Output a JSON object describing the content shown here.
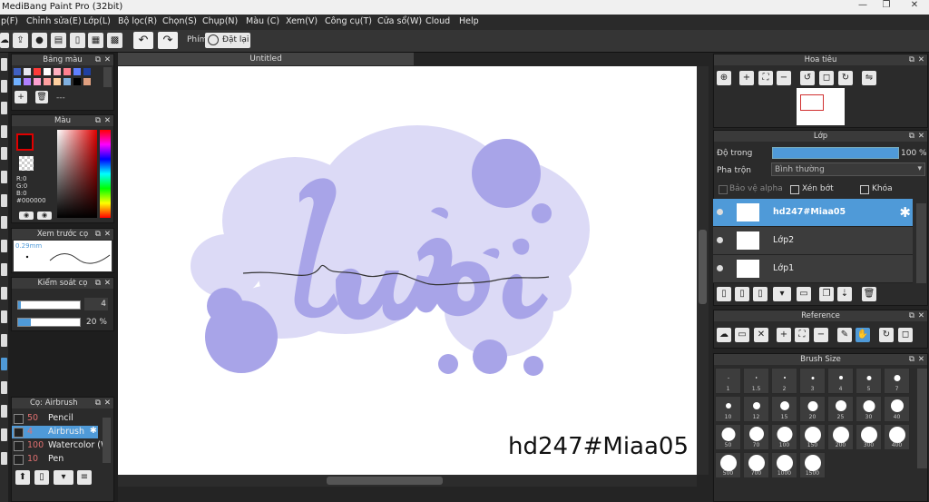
{
  "window": {
    "title": "MediBang Paint Pro (32bit)",
    "minimize": "—",
    "restore": "❐",
    "close": "✕"
  },
  "menu": [
    "p(F)",
    "Chỉnh sửa(E)",
    "Lớp(L)",
    "Bộ lọc(R)",
    "Chọn(S)",
    "Chụp(N)",
    "Màu (C)",
    "Xem(V)",
    "Công cụ(T)",
    "Cửa sổ(W)",
    "Cloud",
    "Help"
  ],
  "toolbar": {
    "shortcut_label": "Phím",
    "reset_label": "Đặt lại"
  },
  "canvas": {
    "tab_title": "Untitled",
    "artwork_text": "lười",
    "watermark": "hd247#Miaa05"
  },
  "palette": {
    "title": "Bảng màu",
    "field_value": "---",
    "colors": [
      "#4060c0",
      "#e8e8f0",
      "#ff3a3a",
      "#ffffff",
      "#ffb0c0",
      "#ff8090",
      "#6080ff",
      "#2040a0",
      "#70b0ff",
      "#b080ff",
      "#ffa0d0",
      "#ffa0a0",
      "#ffd0a0",
      "#80b0e0",
      "#000000",
      "#e0a080"
    ]
  },
  "color_panel": {
    "title": "Màu",
    "r": "R:0",
    "g": "G:0",
    "b": "B:0",
    "hex": "#000000",
    "primary": "#e00000"
  },
  "brush_preview": {
    "title": "Xem trước cọ",
    "size": "0.29mm"
  },
  "brush_control": {
    "title": "Kiểm soát cọ",
    "size_value": "4",
    "opacity_value": "20 %"
  },
  "brushes": {
    "title": "Cọ: Airbrush",
    "items": [
      {
        "num": "50",
        "name": "Pencil",
        "selected": false
      },
      {
        "num": "4",
        "name": "Airbrush",
        "selected": true
      },
      {
        "num": "100",
        "name": "Watercolor (W",
        "selected": false
      },
      {
        "num": "10",
        "name": "Pen",
        "selected": false
      }
    ]
  },
  "navigator": {
    "title": "Hoa tiêu"
  },
  "layers_panel": {
    "title": "Lớp",
    "opacity_label": "Độ trong",
    "opacity_value": "100 %",
    "blend_label": "Pha trộn",
    "blend_value": "Bình thường",
    "protect_alpha": "Bảo vệ alpha",
    "clipping": "Xén bớt",
    "lock": "Khóa",
    "layers": [
      {
        "name": "hd247#Miaa05",
        "selected": true
      },
      {
        "name": "Lớp2",
        "selected": false
      },
      {
        "name": "Lớp1",
        "selected": false
      }
    ]
  },
  "reference": {
    "title": "Reference"
  },
  "brush_size": {
    "title": "Brush Size",
    "sizes": [
      "1",
      "1.5",
      "2",
      "3",
      "4",
      "5",
      "7",
      "10",
      "12",
      "15",
      "20",
      "25",
      "30",
      "40",
      "50",
      "70",
      "100",
      "150",
      "200",
      "300",
      "400",
      "500",
      "700",
      "1000",
      "1500"
    ]
  },
  "colors": {
    "accent": "#4f9ad8",
    "artwork": "#a8a4e8",
    "artwork_bg": "#dcdaf6"
  }
}
